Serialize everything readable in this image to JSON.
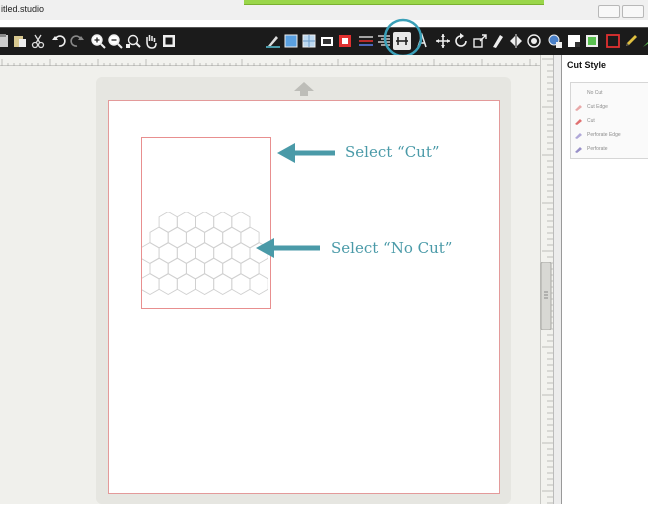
{
  "window": {
    "title": "itled.studio"
  },
  "toolbar": {
    "icons": [
      "clipboard-icon",
      "paste-icon",
      "scissors-icon",
      "undo-icon",
      "redo-icon",
      "zoom-in-icon",
      "zoom-out-icon",
      "zoom-drag-icon",
      "pan-icon",
      "fit-page-icon",
      "line-color-icon",
      "fill-color-icon",
      "fill-pattern-icon",
      "shadow-icon",
      "replicate-icon",
      "line-style-icon",
      "align-icon",
      "cut-settings-icon",
      "text-icon",
      "transform-icon",
      "rotate-icon",
      "scale-icon",
      "shear-icon",
      "mirror-icon",
      "offset-icon",
      "trace-icon",
      "page-icon",
      "registration-icon",
      "library-icon",
      "pencil-icon",
      "knife-icon"
    ],
    "highlight_color": "#3aa0b8"
  },
  "panel": {
    "title": "Cut Style",
    "options": [
      {
        "label": "No Cut",
        "icon": "no-cut-icon"
      },
      {
        "label": "Cut Edge",
        "icon": "cut-edge-icon"
      },
      {
        "label": "Cut",
        "icon": "cut-icon"
      },
      {
        "label": "Perforate Edge",
        "icon": "perforate-edge-icon"
      },
      {
        "label": "Perforate",
        "icon": "perforate-icon"
      }
    ]
  },
  "callouts": {
    "cut": "Select “Cut”",
    "no_cut": "Select “No Cut”",
    "color": "#4a9aa8"
  },
  "colors": {
    "cut_line": "#e88f8f",
    "toolbar_bg": "#1b1b1b"
  }
}
